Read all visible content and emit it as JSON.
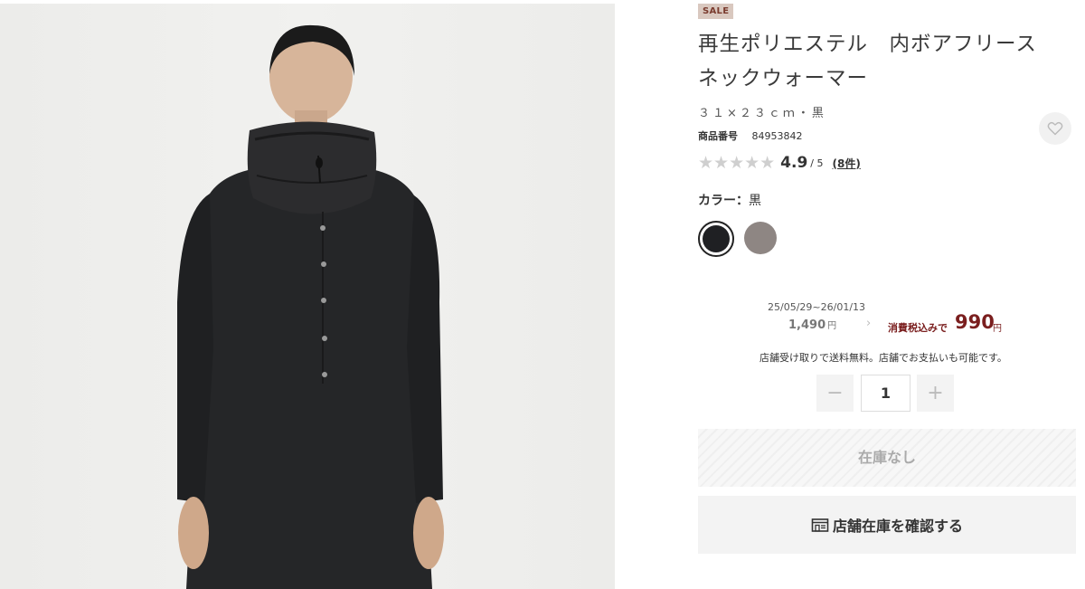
{
  "product": {
    "badge": "SALE",
    "title": "再生ポリエステル　内ボアフリース ネックウォーマー",
    "subtitle": "３１×２３ｃｍ・黒",
    "code_label": "商品番号",
    "code": "84953842",
    "rating": {
      "stars": "★★★★★",
      "score": "4.9",
      "out_of": "/ 5",
      "reviews": "(8件)"
    },
    "color_label": "カラー：",
    "color_value": "黒",
    "swatches": [
      {
        "name": "黒",
        "hex": "#1f2023",
        "selected": true
      },
      {
        "name": "グレー",
        "hex": "#8e8683",
        "selected": false
      }
    ]
  },
  "price": {
    "period": "25/05/29~26/01/13",
    "old_price": "1,490",
    "old_yen": "円",
    "arrow": "›",
    "tax_label": "消費税込みで",
    "new_price": "990",
    "new_yen": "円",
    "note": "店舗受け取りで送料無料。店舗でお支払いも可能です。"
  },
  "quantity": {
    "minus": "−",
    "value": "1",
    "plus": "+"
  },
  "buttons": {
    "out_of_stock": "在庫なし",
    "store_stock": "店舗在庫を確認する"
  },
  "colors": {
    "sale_bg": "#d9c8bf",
    "price_accent": "#7a1e1e"
  },
  "icons": {
    "favorite": "heart-icon",
    "store": "store-icon"
  }
}
